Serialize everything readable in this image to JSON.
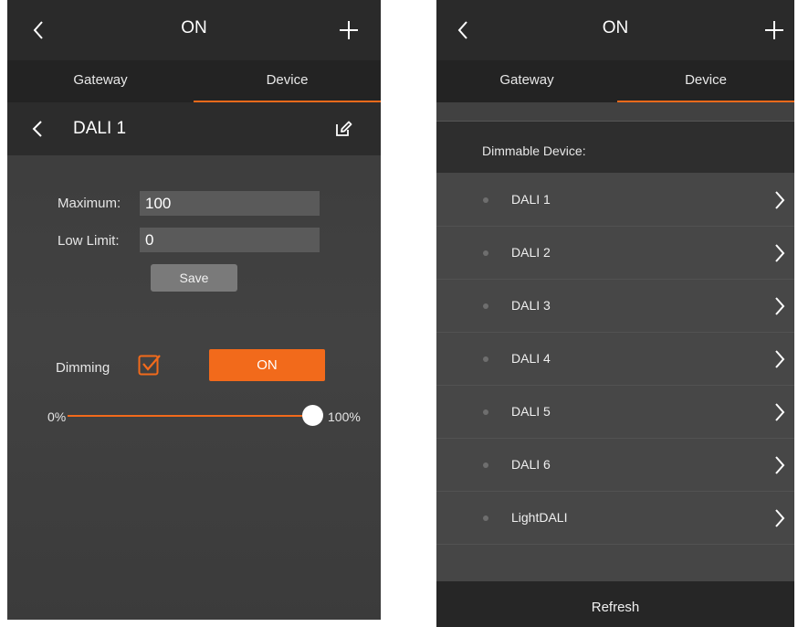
{
  "left": {
    "header": {
      "title": "ON",
      "back_icon": "chevron-left-icon",
      "add_icon": "plus-icon"
    },
    "tabs": [
      {
        "label": "Gateway",
        "active": false
      },
      {
        "label": "Device",
        "active": true
      }
    ],
    "device_header": {
      "name": "DALI 1",
      "edit_icon": "edit-icon"
    },
    "fields": {
      "maximum_label": "Maximum:",
      "maximum_value": "100",
      "low_limit_label": "Low Limit:",
      "low_limit_value": "0"
    },
    "save_label": "Save",
    "dimming": {
      "label": "Dimming",
      "checked": true,
      "on_label": "ON"
    },
    "slider": {
      "min_label": "0%",
      "max_label": "100%",
      "level": 1.0
    }
  },
  "right": {
    "header": {
      "title": "ON",
      "back_icon": "chevron-left-icon",
      "add_icon": "plus-icon"
    },
    "tabs": [
      {
        "label": "Gateway",
        "active": false
      },
      {
        "label": "Device",
        "active": true
      }
    ],
    "section_title": "Dimmable Device:",
    "devices": [
      "DALI 1",
      "DALI 2",
      "DALI 3",
      "DALI 4",
      "DALI 5",
      "DALI 6",
      "LightDALI"
    ],
    "refresh_label": "Refresh"
  },
  "colors": {
    "accent": "#f26a1b",
    "bar": "#2a2a2a",
    "panel": "#464646"
  }
}
